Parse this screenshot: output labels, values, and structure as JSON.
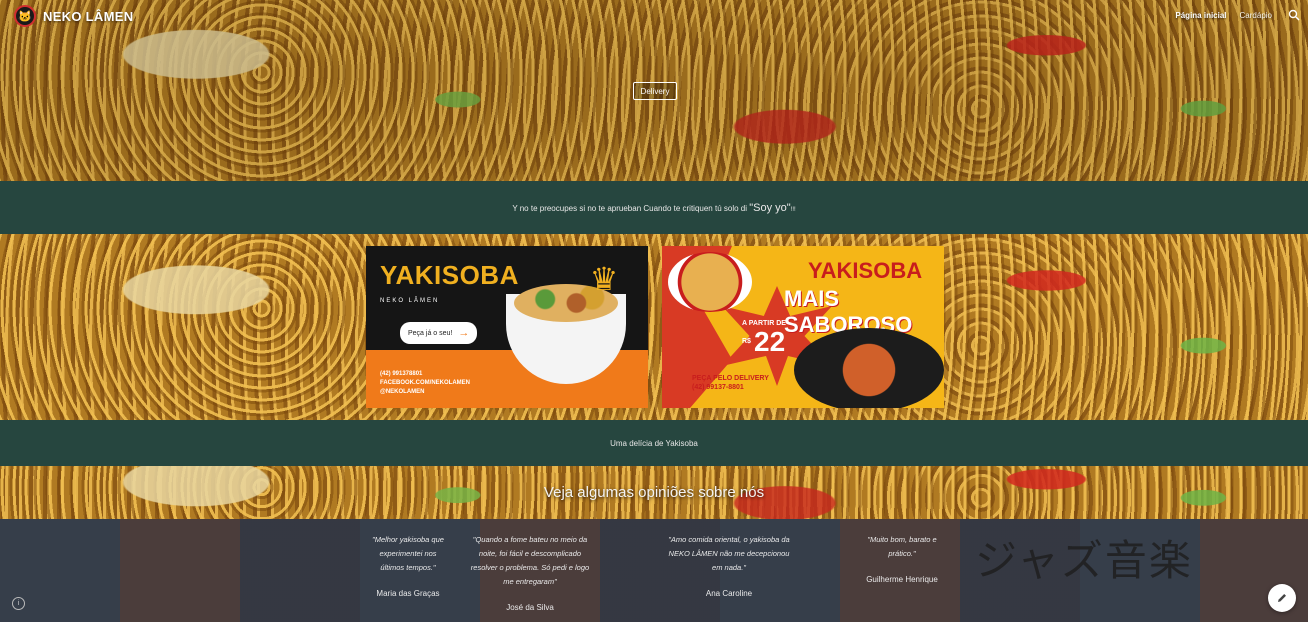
{
  "header": {
    "brand_name": "NEKO LÂMEN",
    "nav": [
      {
        "label": "Página inicial",
        "active": true
      },
      {
        "label": "Cardápio",
        "active": false
      }
    ]
  },
  "hero": {
    "button_label": "Delivery"
  },
  "quote_band": {
    "text_before": "Y no te preocupes si no te aprueban Cuando te critiquen tú solo di ",
    "text_emphasis": "\"Soy yo\"",
    "text_after": "!!!"
  },
  "banner_left": {
    "title": "YAKISOBA",
    "subtitle": "NEKO LÂMEN",
    "cta": "Peça já o seu!",
    "phone": "(42) 991378801",
    "facebook": "FACEBOOK.COM/NEKOLAMEN",
    "instagram": "@NEKOLAMEN"
  },
  "banner_right": {
    "title_line1": "YAKISOBA",
    "title_line2": "MAIS SABOROSO",
    "price_prefix": "A PARTIR DE",
    "currency": "R$",
    "price": "22",
    "delivery_line1": "PEÇA PELO DELIVERY",
    "delivery_line2": "(42) 99137-8801"
  },
  "caption_band": {
    "text": "Uma delícia de Yakisoba"
  },
  "opinions": {
    "heading": "Veja algumas opiniões sobre nós",
    "reviews": [
      {
        "quote": "\"Melhor yakisoba que experimentei nos últimos tempos.\"",
        "author": "Maria das Graças"
      },
      {
        "quote": "\"Quando a fome bateu no meio da noite, foi fácil e descomplicado resolver o problema. Só pedi e logo me entregaram\"",
        "author": "José da Silva"
      },
      {
        "quote": "\"Amo comida oriental, o yakisoba da NEKO LÂMEN não me decepcionou em nada.\"",
        "author": "Ana Caroline"
      },
      {
        "quote": "\"Muito bom, barato e prático.\"",
        "author": "Guilherme Henrique"
      }
    ],
    "background_sign": "ジャズ音楽"
  },
  "icons": {
    "search": "search-icon",
    "edit": "pencil-icon",
    "info": "info-icon",
    "logo": "cat-logo-icon"
  },
  "colors": {
    "band": "#26463f",
    "accent_orange": "#f07a1a",
    "accent_red": "#c81d1d",
    "accent_yellow": "#f5b617"
  }
}
